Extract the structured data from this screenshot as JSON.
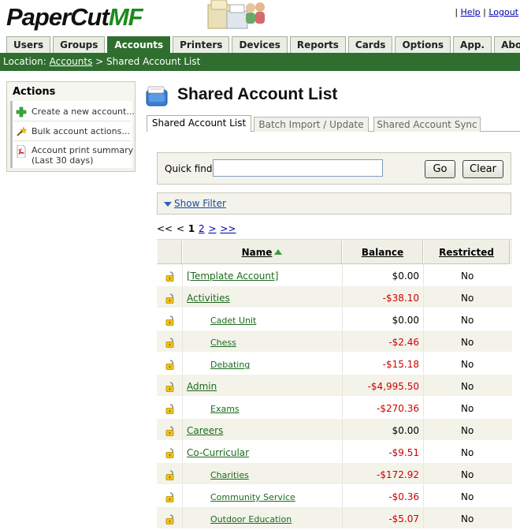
{
  "header": {
    "logo_main": "PaperCut",
    "logo_suffix": "MF",
    "help_label": "Help",
    "logout_label": "Logout",
    "link_separator": "|"
  },
  "nav": {
    "tabs": [
      {
        "label": "Users",
        "active": false
      },
      {
        "label": "Groups",
        "active": false
      },
      {
        "label": "Accounts",
        "active": true
      },
      {
        "label": "Printers",
        "active": false
      },
      {
        "label": "Devices",
        "active": false
      },
      {
        "label": "Reports",
        "active": false
      },
      {
        "label": "Cards",
        "active": false
      },
      {
        "label": "Options",
        "active": false
      },
      {
        "label": "App. Log",
        "active": false
      },
      {
        "label": "About",
        "active": false
      }
    ]
  },
  "location": {
    "prefix": "Location:",
    "crumb": "Accounts",
    "separator": ">",
    "current": "Shared Account List"
  },
  "actions": {
    "title": "Actions",
    "items": [
      {
        "label": "Create a new account...",
        "icon": "plus-icon"
      },
      {
        "label": "Bulk account actions...",
        "icon": "magic-wand-icon"
      },
      {
        "label": "Account print summary",
        "label2": "(Last 30 days)",
        "icon": "pdf-icon"
      }
    ]
  },
  "page": {
    "title": "Shared Account List",
    "subtabs": [
      "Shared Account List",
      "Batch Import / Update",
      "Shared Account Sync"
    ]
  },
  "quickfind": {
    "label": "Quick find:",
    "value": "",
    "go_label": "Go",
    "clear_label": "Clear"
  },
  "filter": {
    "label": "Show Filter"
  },
  "pager": {
    "first": "<<",
    "prev": "<",
    "current": "1",
    "page2": "2",
    "next": ">",
    "last": ">>"
  },
  "table": {
    "columns": {
      "name": "Name",
      "balance": "Balance",
      "restricted": "Restricted"
    },
    "rows": [
      {
        "name": "[Template Account]",
        "balance": "$0.00",
        "restricted": "No",
        "sub": false,
        "negative": false
      },
      {
        "name": "Activities",
        "balance": "-$38.10",
        "restricted": "No",
        "sub": false,
        "negative": true
      },
      {
        "name": "Cadet Unit",
        "balance": "$0.00",
        "restricted": "No",
        "sub": true,
        "negative": false
      },
      {
        "name": "Chess",
        "balance": "-$2.46",
        "restricted": "No",
        "sub": true,
        "negative": true
      },
      {
        "name": "Debating",
        "balance": "-$15.18",
        "restricted": "No",
        "sub": true,
        "negative": true
      },
      {
        "name": "Admin",
        "balance": "-$4,995.50",
        "restricted": "No",
        "sub": false,
        "negative": true
      },
      {
        "name": "Exams",
        "balance": "-$270.36",
        "restricted": "No",
        "sub": true,
        "negative": true
      },
      {
        "name": "Careers",
        "balance": "$0.00",
        "restricted": "No",
        "sub": false,
        "negative": false
      },
      {
        "name": "Co-Curricular",
        "balance": "-$9.51",
        "restricted": "No",
        "sub": false,
        "negative": true
      },
      {
        "name": "Charities",
        "balance": "-$172.92",
        "restricted": "No",
        "sub": true,
        "negative": true
      },
      {
        "name": "Community Service",
        "balance": "-$0.36",
        "restricted": "No",
        "sub": true,
        "negative": true
      },
      {
        "name": "Outdoor Education",
        "balance": "-$5.07",
        "restricted": "No",
        "sub": true,
        "negative": true
      }
    ]
  },
  "colors": {
    "accent_green": "#2f6e2f",
    "link_green": "#1d6a1d",
    "negative_red": "#d00000"
  }
}
